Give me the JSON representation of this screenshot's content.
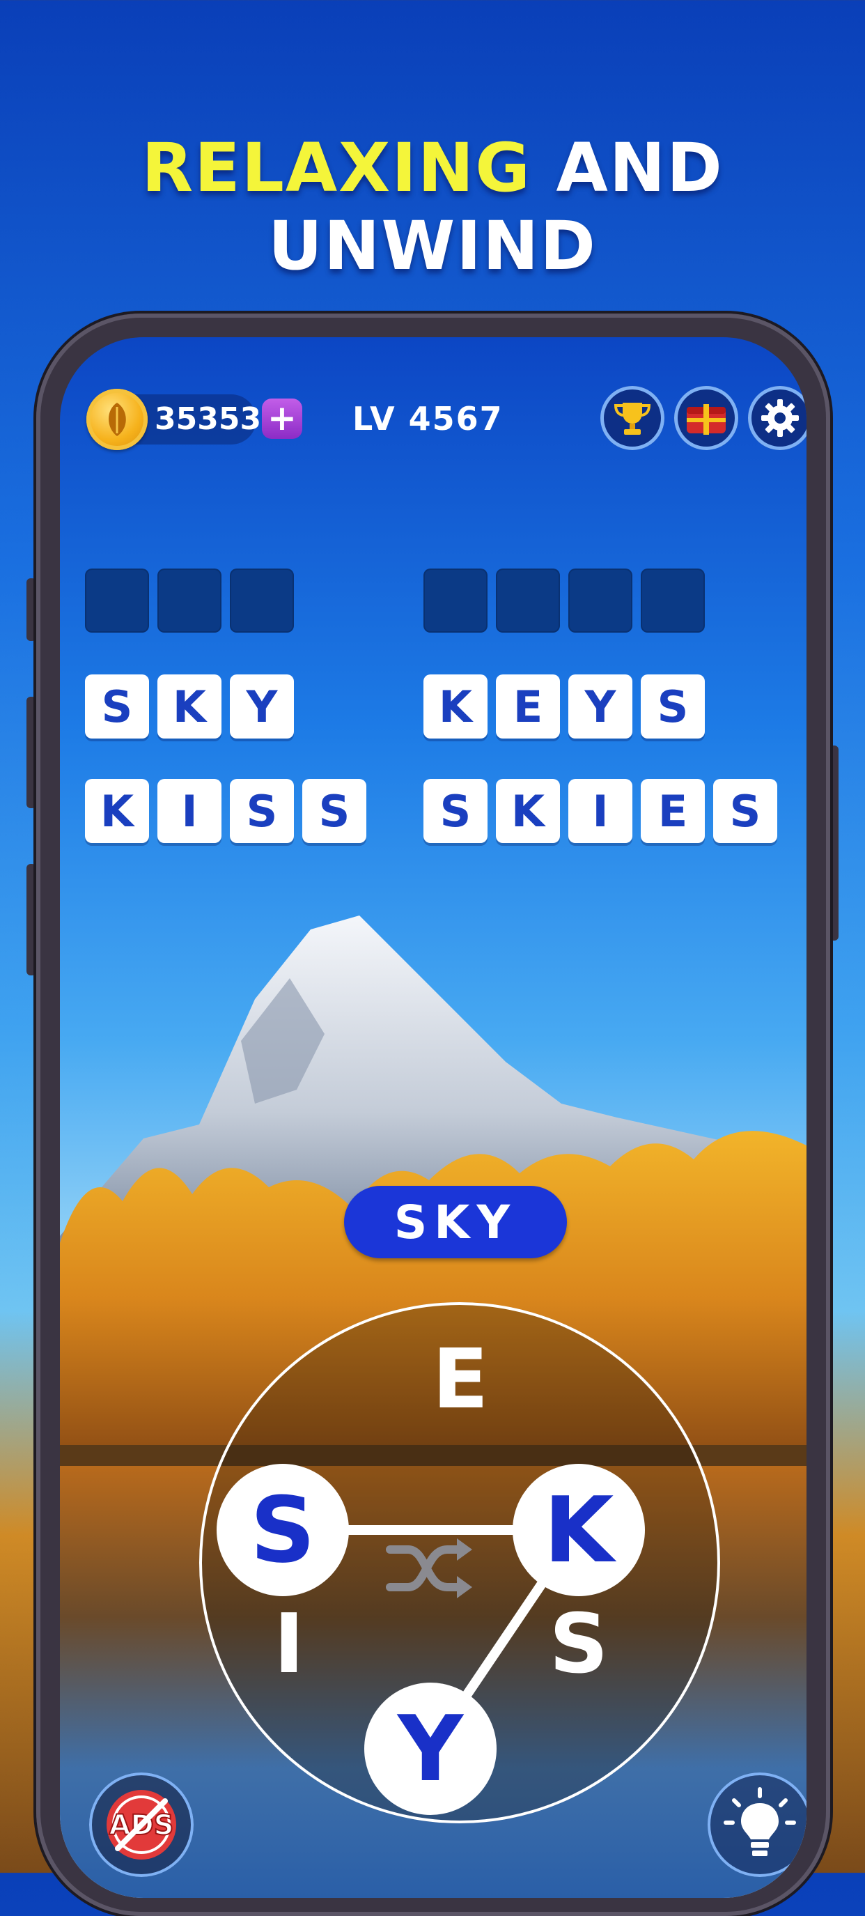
{
  "headline": {
    "highlight": "RELAXING",
    "rest": "AND UNWIND"
  },
  "topbar": {
    "coins": "35353",
    "plus": "+",
    "level": "LV 4567"
  },
  "icons": {
    "coin": "leaf-coin-icon",
    "trophy": "trophy-icon",
    "gift": "gift-chest-icon",
    "settings": "gear-icon",
    "no_ads": "no-ads-icon",
    "hint": "lightbulb-icon",
    "shuffle": "shuffle-icon"
  },
  "answers": {
    "left": [
      {
        "letters": [
          "",
          "",
          ""
        ],
        "solved": false
      },
      {
        "letters": [
          "S",
          "K",
          "Y"
        ],
        "solved": true
      },
      {
        "letters": [
          "K",
          "I",
          "S",
          "S"
        ],
        "solved": true
      }
    ],
    "right": [
      {
        "letters": [
          "",
          "",
          "",
          ""
        ],
        "solved": false
      },
      {
        "letters": [
          "K",
          "E",
          "Y",
          "S"
        ],
        "solved": true
      },
      {
        "letters": [
          "S",
          "K",
          "I",
          "E",
          "S"
        ],
        "solved": true
      }
    ]
  },
  "current_word": "SKY",
  "wheel": {
    "letters": [
      "E",
      "S",
      "K",
      "I",
      "S",
      "Y"
    ],
    "selected": [
      "S",
      "K",
      "Y"
    ]
  },
  "no_ads_label": "ADS",
  "colors": {
    "accent": "#1b36d8",
    "headline_highlight": "#f4f53a",
    "tile_empty": "#0b3a86",
    "tile_text": "#1a3fbf"
  }
}
